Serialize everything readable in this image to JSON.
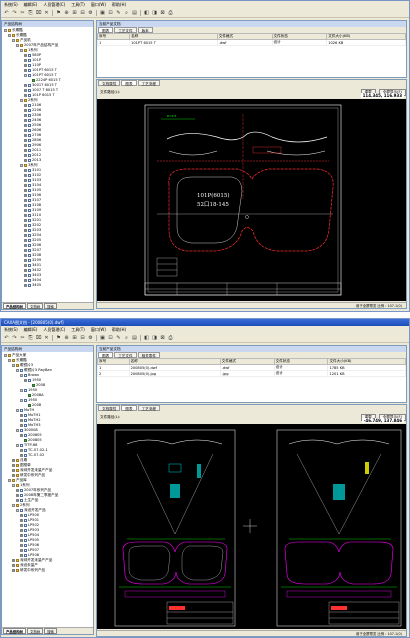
{
  "window1": {
    "menu": [
      "系统(S)",
      "编辑(E)",
      "人员管理(C)",
      "工具(T)",
      "窗口(W)",
      "帮助(H)"
    ],
    "left_header": "产品结构树",
    "tree": [
      {
        "depth": 0,
        "exp": "-",
        "icon": "folder",
        "label": "长期酷"
      },
      {
        "depth": 1,
        "exp": "-",
        "icon": "folder",
        "label": "长期酷"
      },
      {
        "depth": 2,
        "exp": "-",
        "icon": "folder",
        "label": "产品机"
      },
      {
        "depth": 3,
        "exp": "-",
        "icon": "folder",
        "label": "2007年产品结构产品"
      },
      {
        "depth": 4,
        "exp": "-",
        "icon": "folder",
        "label": "1系列"
      },
      {
        "depth": 5,
        "exp": "+",
        "icon": "doc",
        "label": "580P"
      },
      {
        "depth": 5,
        "exp": "+",
        "icon": "doc",
        "label": "101P"
      },
      {
        "depth": 5,
        "exp": "+",
        "icon": "doc",
        "label": "110P"
      },
      {
        "depth": 5,
        "exp": "+",
        "icon": "doc",
        "label": "101PT 6015 T"
      },
      {
        "depth": 5,
        "exp": "-",
        "icon": "doc",
        "label": "101PT 6015 T"
      },
      {
        "depth": 6,
        "exp": "",
        "icon": "part",
        "label": "2224P 6015 T"
      },
      {
        "depth": 5,
        "exp": "+",
        "icon": "doc",
        "label": "3001T 6015 T"
      },
      {
        "depth": 5,
        "exp": "+",
        "icon": "doc",
        "label": "1007 T 6015 T"
      },
      {
        "depth": 5,
        "exp": "+",
        "icon": "doc",
        "label": "101P 6015 T"
      },
      {
        "depth": 4,
        "exp": "-",
        "icon": "folder",
        "label": "2系列"
      },
      {
        "depth": 5,
        "exp": "+",
        "icon": "doc",
        "label": "2106"
      },
      {
        "depth": 5,
        "exp": "+",
        "icon": "doc",
        "label": "2206"
      },
      {
        "depth": 5,
        "exp": "+",
        "icon": "doc",
        "label": "2306"
      },
      {
        "depth": 5,
        "exp": "+",
        "icon": "doc",
        "label": "2406"
      },
      {
        "depth": 5,
        "exp": "+",
        "icon": "doc",
        "label": "2506"
      },
      {
        "depth": 5,
        "exp": "+",
        "icon": "doc",
        "label": "2606"
      },
      {
        "depth": 5,
        "exp": "+",
        "icon": "doc",
        "label": "2706"
      },
      {
        "depth": 5,
        "exp": "+",
        "icon": "doc",
        "label": "2806"
      },
      {
        "depth": 5,
        "exp": "+",
        "icon": "doc",
        "label": "2906"
      },
      {
        "depth": 5,
        "exp": "+",
        "icon": "doc",
        "label": "2011"
      },
      {
        "depth": 5,
        "exp": "+",
        "icon": "doc",
        "label": "2012"
      },
      {
        "depth": 5,
        "exp": "+",
        "icon": "doc",
        "label": "2013"
      },
      {
        "depth": 4,
        "exp": "-",
        "icon": "folder",
        "label": "3系列"
      },
      {
        "depth": 5,
        "exp": "+",
        "icon": "doc",
        "label": "3101"
      },
      {
        "depth": 5,
        "exp": "+",
        "icon": "doc",
        "label": "3102"
      },
      {
        "depth": 5,
        "exp": "+",
        "icon": "doc",
        "label": "3103"
      },
      {
        "depth": 5,
        "exp": "+",
        "icon": "doc",
        "label": "3104"
      },
      {
        "depth": 5,
        "exp": "+",
        "icon": "doc",
        "label": "3105"
      },
      {
        "depth": 5,
        "exp": "+",
        "icon": "doc",
        "label": "3106"
      },
      {
        "depth": 5,
        "exp": "+",
        "icon": "doc",
        "label": "3107"
      },
      {
        "depth": 5,
        "exp": "+",
        "icon": "doc",
        "label": "3108"
      },
      {
        "depth": 5,
        "exp": "+",
        "icon": "doc",
        "label": "3109"
      },
      {
        "depth": 5,
        "exp": "+",
        "icon": "doc",
        "label": "3110"
      },
      {
        "depth": 5,
        "exp": "+",
        "icon": "doc",
        "label": "3201"
      },
      {
        "depth": 5,
        "exp": "+",
        "icon": "doc",
        "label": "3202"
      },
      {
        "depth": 5,
        "exp": "+",
        "icon": "doc",
        "label": "3203"
      },
      {
        "depth": 5,
        "exp": "+",
        "icon": "doc",
        "label": "3204"
      },
      {
        "depth": 5,
        "exp": "+",
        "icon": "doc",
        "label": "3205"
      },
      {
        "depth": 5,
        "exp": "+",
        "icon": "doc",
        "label": "3206"
      },
      {
        "depth": 5,
        "exp": "+",
        "icon": "doc",
        "label": "3207"
      },
      {
        "depth": 5,
        "exp": "+",
        "icon": "doc",
        "label": "3208"
      },
      {
        "depth": 5,
        "exp": "+",
        "icon": "doc",
        "label": "3209"
      },
      {
        "depth": 5,
        "exp": "+",
        "icon": "doc",
        "label": "3401"
      },
      {
        "depth": 5,
        "exp": "+",
        "icon": "doc",
        "label": "3402"
      },
      {
        "depth": 5,
        "exp": "+",
        "icon": "doc",
        "label": "3403"
      },
      {
        "depth": 5,
        "exp": "+",
        "icon": "doc",
        "label": "3404"
      },
      {
        "depth": 5,
        "exp": "+",
        "icon": "doc",
        "label": "3405"
      }
    ],
    "left_tabs": [
      "产品结构树",
      "文档树",
      "搜索"
    ],
    "right_header": "当前产品文档",
    "tabs": [
      "图表",
      "工艺文件",
      "版本"
    ],
    "table_headers": [
      "序号",
      "名称",
      "文件格式",
      "文件状态",
      "文件大小(KB)"
    ],
    "table_rows": [
      [
        "1",
        "101PT 6015 T",
        ".dwf",
        "设计",
        "1026 KB"
      ]
    ],
    "viewer_tabs": [
      "文档属性",
      "图表",
      "工艺流程"
    ],
    "viewer_label": "文件路径(L):",
    "viewer_btns": [
      "重载",
      "全屏显示(F)"
    ],
    "coord": "114.345, 116.933",
    "drawing_text": [
      "101P(6015)",
      "52口18-145"
    ],
    "status": "用于全屏预览 比例 : 107.1(0)"
  },
  "window2": {
    "title": "CAXA图文档 - [200805(0).dwf]",
    "menu": [
      "系统(S)",
      "编辑(E)",
      "人员管理(C)",
      "工具(T)",
      "窗口(W)",
      "帮助(H)"
    ],
    "left_header": "产品结构树",
    "tree": [
      {
        "depth": 0,
        "exp": "-",
        "icon": "folder",
        "label": "产品大家"
      },
      {
        "depth": 1,
        "exp": "-",
        "icon": "folder",
        "label": "长期酷"
      },
      {
        "depth": 2,
        "exp": "-",
        "icon": "folder",
        "label": "眼镜片3"
      },
      {
        "depth": 3,
        "exp": "-",
        "icon": "doc",
        "label": "眼镜片3 RayBan"
      },
      {
        "depth": 4,
        "exp": "-",
        "icon": "doc",
        "label": "Brown"
      },
      {
        "depth": 5,
        "exp": "+",
        "icon": "doc",
        "label": "1950"
      },
      {
        "depth": 6,
        "exp": "",
        "icon": "part",
        "label": "2008"
      },
      {
        "depth": 4,
        "exp": "-",
        "icon": "doc",
        "label": "1950"
      },
      {
        "depth": 5,
        "exp": "",
        "icon": "part",
        "label": "2008A"
      },
      {
        "depth": 4,
        "exp": "-",
        "icon": "doc",
        "label": "1950"
      },
      {
        "depth": 5,
        "exp": "",
        "icon": "part",
        "label": "2008"
      },
      {
        "depth": 3,
        "exp": "-",
        "icon": "doc",
        "label": "MoTH"
      },
      {
        "depth": 4,
        "exp": "+",
        "icon": "doc",
        "label": "MoTH1"
      },
      {
        "depth": 4,
        "exp": "+",
        "icon": "doc",
        "label": "MoTH2"
      },
      {
        "depth": 4,
        "exp": "+",
        "icon": "doc",
        "label": "MoTH3"
      },
      {
        "depth": 3,
        "exp": "-",
        "icon": "doc",
        "label": "300008"
      },
      {
        "depth": 4,
        "exp": "+",
        "icon": "doc",
        "label": "200805"
      },
      {
        "depth": 4,
        "exp": "",
        "icon": "part",
        "label": "200805"
      },
      {
        "depth": 3,
        "exp": "-",
        "icon": "doc",
        "label": "TITP-68"
      },
      {
        "depth": 4,
        "exp": "+",
        "icon": "doc",
        "label": "TC-07-02-1"
      },
      {
        "depth": 4,
        "exp": "+",
        "icon": "doc",
        "label": "TC-07-02"
      },
      {
        "depth": 2,
        "exp": "+",
        "icon": "folder",
        "label": "月期"
      },
      {
        "depth": 2,
        "exp": "+",
        "icon": "folder",
        "label": "图框单"
      },
      {
        "depth": 2,
        "exp": "+",
        "icon": "folder",
        "label": "深圳开发未量产产品"
      },
      {
        "depth": 2,
        "exp": "+",
        "icon": "folder",
        "label": "研发中系列产品"
      },
      {
        "depth": 1,
        "exp": "-",
        "icon": "folder",
        "label": "产品库"
      },
      {
        "depth": 2,
        "exp": "-",
        "icon": "folder",
        "label": "1系列"
      },
      {
        "depth": 3,
        "exp": "+",
        "icon": "doc",
        "label": "2007年系列产品"
      },
      {
        "depth": 3,
        "exp": "+",
        "icon": "doc",
        "label": "2008年第二季度产品"
      },
      {
        "depth": 3,
        "exp": "+",
        "icon": "doc",
        "label": "土生产品"
      },
      {
        "depth": 2,
        "exp": "-",
        "icon": "folder",
        "label": "2系列"
      },
      {
        "depth": 3,
        "exp": "-",
        "icon": "doc",
        "label": "深设开发产品"
      },
      {
        "depth": 4,
        "exp": "+",
        "icon": "doc",
        "label": "LP500"
      },
      {
        "depth": 4,
        "exp": "+",
        "icon": "doc",
        "label": "LP501"
      },
      {
        "depth": 4,
        "exp": "+",
        "icon": "doc",
        "label": "LP502"
      },
      {
        "depth": 4,
        "exp": "+",
        "icon": "doc",
        "label": "LP503"
      },
      {
        "depth": 4,
        "exp": "+",
        "icon": "doc",
        "label": "LP504"
      },
      {
        "depth": 4,
        "exp": "+",
        "icon": "doc",
        "label": "LP505"
      },
      {
        "depth": 4,
        "exp": "+",
        "icon": "doc",
        "label": "LP506"
      },
      {
        "depth": 4,
        "exp": "+",
        "icon": "doc",
        "label": "LP507"
      },
      {
        "depth": 4,
        "exp": "+",
        "icon": "doc",
        "label": "LP508"
      },
      {
        "depth": 2,
        "exp": "+",
        "icon": "folder",
        "label": "深圳开发未量产产品"
      },
      {
        "depth": 2,
        "exp": "+",
        "icon": "folder",
        "label": "深设未量产"
      },
      {
        "depth": 2,
        "exp": "+",
        "icon": "folder",
        "label": "研发中系列产品"
      }
    ],
    "left_tabs": [
      "产品结构树",
      "文档树",
      "搜索"
    ],
    "right_header": "当前产品文档",
    "tabs": [
      "图表",
      "工艺文件",
      "相关零件"
    ],
    "table_headers": [
      "序号",
      "名称",
      "文件格式",
      "文件状态",
      "文件大小(KB)"
    ],
    "table_rows": [
      [
        "1",
        "200805(0).dwf",
        ".dwf",
        "设计",
        "1785 KB"
      ],
      [
        "2",
        "200805(0).jpg",
        ".jpg",
        "设计",
        "1201 KB"
      ]
    ],
    "viewer_tabs": [
      "文档属性",
      "图表",
      "工艺流程"
    ],
    "viewer_label": "文件路径(L):",
    "viewer_btns": [
      "重载",
      "全屏显示(F)"
    ],
    "coord": "-46.749, 137.846",
    "status": "用于全屏预览 比例 : 107.1(0)"
  },
  "colors": {
    "title_bar": "#1c4cb8",
    "canvas": "#000000",
    "cad_white": "#ffffff",
    "cad_red": "#ff3030",
    "cad_green": "#00ff00",
    "cad_cyan": "#00ffff",
    "cad_magenta": "#ff00ff",
    "cad_yellow": "#ffff00"
  }
}
